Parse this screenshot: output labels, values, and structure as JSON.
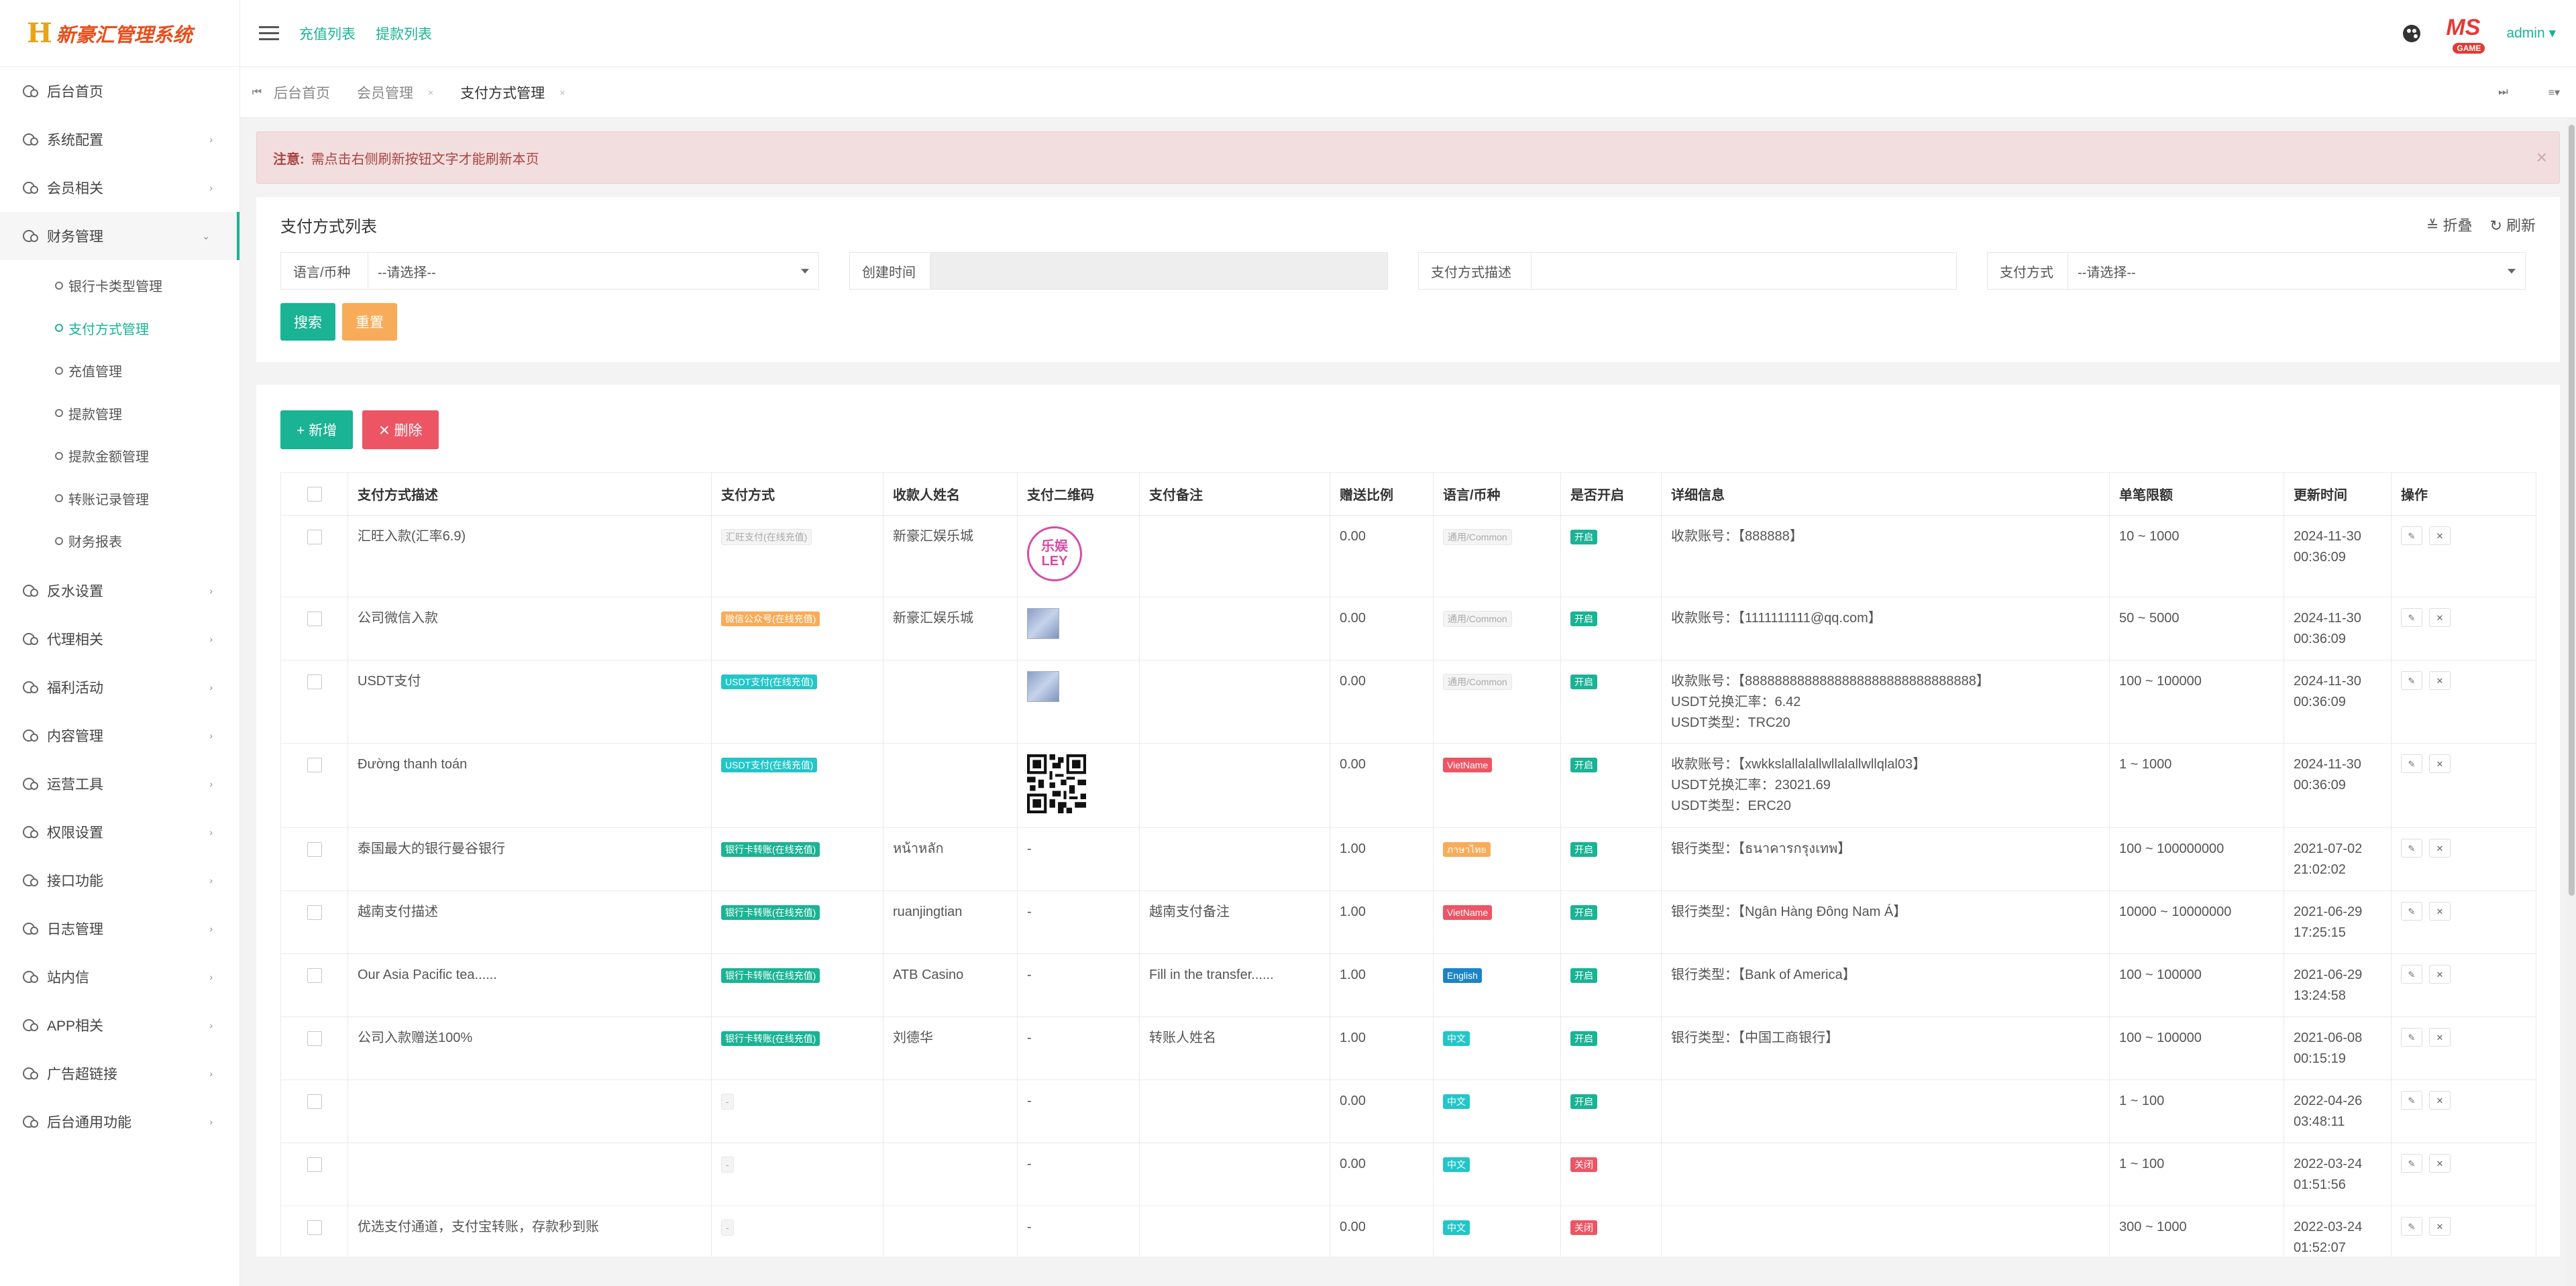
{
  "app": {
    "logo_mark": "H",
    "title": "新豪汇管理系统"
  },
  "sidebar": {
    "items": [
      {
        "label": "后台首页",
        "arrow": ""
      },
      {
        "label": "系统配置",
        "arrow": "›"
      },
      {
        "label": "会员相关",
        "arrow": "›"
      },
      {
        "label": "财务管理",
        "arrow": "⌄"
      },
      {
        "label": "反水设置",
        "arrow": "›"
      },
      {
        "label": "代理相关",
        "arrow": "›"
      },
      {
        "label": "福利活动",
        "arrow": "›"
      },
      {
        "label": "内容管理",
        "arrow": "›"
      },
      {
        "label": "运营工具",
        "arrow": "›"
      },
      {
        "label": "权限设置",
        "arrow": "›"
      },
      {
        "label": "接口功能",
        "arrow": "›"
      },
      {
        "label": "日志管理",
        "arrow": "›"
      },
      {
        "label": "站内信",
        "arrow": "›"
      },
      {
        "label": "APP相关",
        "arrow": "›"
      },
      {
        "label": "广告超链接",
        "arrow": "›"
      },
      {
        "label": "后台通用功能",
        "arrow": "›"
      }
    ],
    "sub_items": [
      "银行卡类型管理",
      "支付方式管理",
      "充值管理",
      "提款管理",
      "提款金额管理",
      "转账记录管理",
      "财务报表"
    ]
  },
  "topbar": {
    "links": [
      "充值列表",
      "提款列表"
    ],
    "brand_ms": "MS",
    "brand_game": "GAME",
    "user": "admin ▾"
  },
  "tabs": {
    "first": "⏮",
    "crumbs": [
      "后台首页",
      "会员管理",
      "支付方式管理"
    ],
    "close": "×",
    "last": "⏭",
    "menu": "≡▾"
  },
  "alert": {
    "title": "注意:",
    "text": "需点击右侧刷新按钮文字才能刷新本页",
    "close": "×"
  },
  "filter_panel": {
    "title": "支付方式列表",
    "collapse": "≚ 折叠",
    "refresh": "↻ 刷新",
    "fields": [
      {
        "label": "语言/币种",
        "value": "--请选择--"
      },
      {
        "label": "创建时间",
        "value": ""
      },
      {
        "label": "支付方式描述",
        "value": ""
      },
      {
        "label": "支付方式",
        "value": "--请选择--"
      }
    ],
    "search": "搜索",
    "reset": "重置"
  },
  "table": {
    "add": "+ 新增",
    "delete": "✕ 删除",
    "columns": [
      "支付方式描述",
      "支付方式",
      "收款人姓名",
      "支付二维码",
      "支付备注",
      "赠送比例",
      "语言/币种",
      "是否开启",
      "详细信息",
      "单笔限额",
      "更新时间",
      "操作"
    ],
    "rows": [
      {
        "desc": "汇旺入款(汇率6.9)",
        "method": "汇旺支付(在线充值)",
        "method_style": "default",
        "payee": "新豪汇娱乐城",
        "qr": "logo",
        "qr_text_1": "乐娱",
        "qr_text_2": "LEY",
        "note": "",
        "ratio": "0.00",
        "lang": "通用/Common",
        "lang_style": "default",
        "status": "开启",
        "status_style": "green",
        "detail": [
          "收款账号：【888888】"
        ],
        "limit": "10 ~ 1000",
        "date": "2024-11-30",
        "time": "00:36:09"
      },
      {
        "desc": "公司微信入款",
        "method": "微信公众号(在线充值)",
        "method_style": "orange",
        "payee": "新豪汇娱乐城",
        "qr": "img",
        "note": "",
        "ratio": "0.00",
        "lang": "通用/Common",
        "lang_style": "default",
        "status": "开启",
        "status_style": "green",
        "detail": [
          "收款账号：【1111111111@qq.com】"
        ],
        "limit": "50 ~ 5000",
        "date": "2024-11-30",
        "time": "00:36:09"
      },
      {
        "desc": "USDT支付",
        "method": "USDT支付(在线充值)",
        "method_style": "teal",
        "payee": "",
        "qr": "img",
        "note": "",
        "ratio": "0.00",
        "lang": "通用/Common",
        "lang_style": "default",
        "status": "开启",
        "status_style": "green",
        "detail": [
          "收款账号：【8888888888888888888888888888888】",
          "USDT兑换汇率：6.42",
          "USDT类型：TRC20"
        ],
        "limit": "100 ~ 100000",
        "date": "2024-11-30",
        "time": "00:36:09"
      },
      {
        "desc": "Đường thanh toán",
        "method": "USDT支付(在线充值)",
        "method_style": "teal",
        "payee": "",
        "qr": "code",
        "note": "",
        "ratio": "0.00",
        "lang": "VietName",
        "lang_style": "red",
        "status": "开启",
        "status_style": "green",
        "detail": [
          "收款账号：【xwkkslallalallwllalallwllqlal03】",
          "USDT兑换汇率：23021.69",
          "USDT类型：ERC20"
        ],
        "limit": "1 ~ 1000",
        "date": "2024-11-30",
        "time": "00:36:09"
      },
      {
        "desc": "泰国最大的银行曼谷银行",
        "method": "银行卡转账(在线充值)",
        "method_style": "green",
        "payee": "หน้าหลัก",
        "qr": "dash",
        "qr_text": "-",
        "note": "",
        "ratio": "1.00",
        "lang": "ภาษาไทย",
        "lang_style": "orange",
        "status": "开启",
        "status_style": "green",
        "detail": [
          "银行类型：【ธนาคารกรุงเทพ】"
        ],
        "limit": "100 ~ 100000000",
        "date": "2021-07-02",
        "time": "21:02:02"
      },
      {
        "desc": "越南支付描述",
        "method": "银行卡转账(在线充值)",
        "method_style": "green",
        "payee": "ruanjingtian",
        "qr": "dash",
        "qr_text": "-",
        "note": "越南支付备注",
        "ratio": "1.00",
        "lang": "VietName",
        "lang_style": "red",
        "status": "开启",
        "status_style": "green",
        "detail": [
          "银行类型：【Ngân Hàng Đông Nam Á】"
        ],
        "limit": "10000 ~ 10000000",
        "date": "2021-06-29",
        "time": "17:25:15"
      },
      {
        "desc": "Our Asia Pacific tea......",
        "method": "银行卡转账(在线充值)",
        "method_style": "green",
        "payee": "ATB Casino",
        "qr": "dash",
        "qr_text": "-",
        "note": "Fill in the transfer......",
        "ratio": "1.00",
        "lang": "English",
        "lang_style": "blue",
        "status": "开启",
        "status_style": "green",
        "detail": [
          "银行类型：【Bank of America】"
        ],
        "limit": "100 ~ 100000",
        "date": "2021-06-29",
        "time": "13:24:58"
      },
      {
        "desc": "公司入款赠送100%",
        "method": "银行卡转账(在线充值)",
        "method_style": "green",
        "payee": "刘德华",
        "qr": "dash",
        "qr_text": "-",
        "note": "转账人姓名",
        "ratio": "1.00",
        "lang": "中文",
        "lang_style": "teal",
        "status": "开启",
        "status_style": "green",
        "detail": [
          "银行类型：【中国工商银行】"
        ],
        "limit": "100 ~ 100000",
        "date": "2021-06-08",
        "time": "00:15:19"
      },
      {
        "desc": "",
        "method": "-",
        "method_style": "default",
        "payee": "",
        "qr": "dash",
        "qr_text": "-",
        "note": "",
        "ratio": "0.00",
        "lang": "中文",
        "lang_style": "teal",
        "status": "开启",
        "status_style": "green",
        "detail": [],
        "limit": "1 ~ 100",
        "date": "2022-04-26",
        "time": "03:48:11"
      },
      {
        "desc": "",
        "method": "-",
        "method_style": "default",
        "payee": "",
        "qr": "dash",
        "qr_text": "-",
        "note": "",
        "ratio": "0.00",
        "lang": "中文",
        "lang_style": "teal",
        "status": "关闭",
        "status_style": "red",
        "detail": [],
        "limit": "1 ~ 100",
        "date": "2022-03-24",
        "time": "01:51:56"
      },
      {
        "desc": "优选支付通道，支付宝转账，存款秒到账",
        "method": "-",
        "method_style": "default",
        "payee": "",
        "qr": "dash",
        "qr_text": "-",
        "note": "",
        "ratio": "0.00",
        "lang": "中文",
        "lang_style": "teal",
        "status": "关闭",
        "status_style": "red",
        "detail": [],
        "limit": "300 ~ 1000",
        "date": "2022-03-24",
        "time": "01:52:07"
      }
    ],
    "op_edit": "✎",
    "op_delete": "✕"
  },
  "colors": {
    "accent": "#1ab394",
    "danger": "#ed5565",
    "warning": "#f8ac59",
    "info": "#23c6c8",
    "primary": "#1c84c6"
  },
  "icons": {
    "collapse": "chevron-up-icon",
    "refresh": "refresh-icon",
    "palette": "palette-icon",
    "menu": "hamburger-icon"
  }
}
